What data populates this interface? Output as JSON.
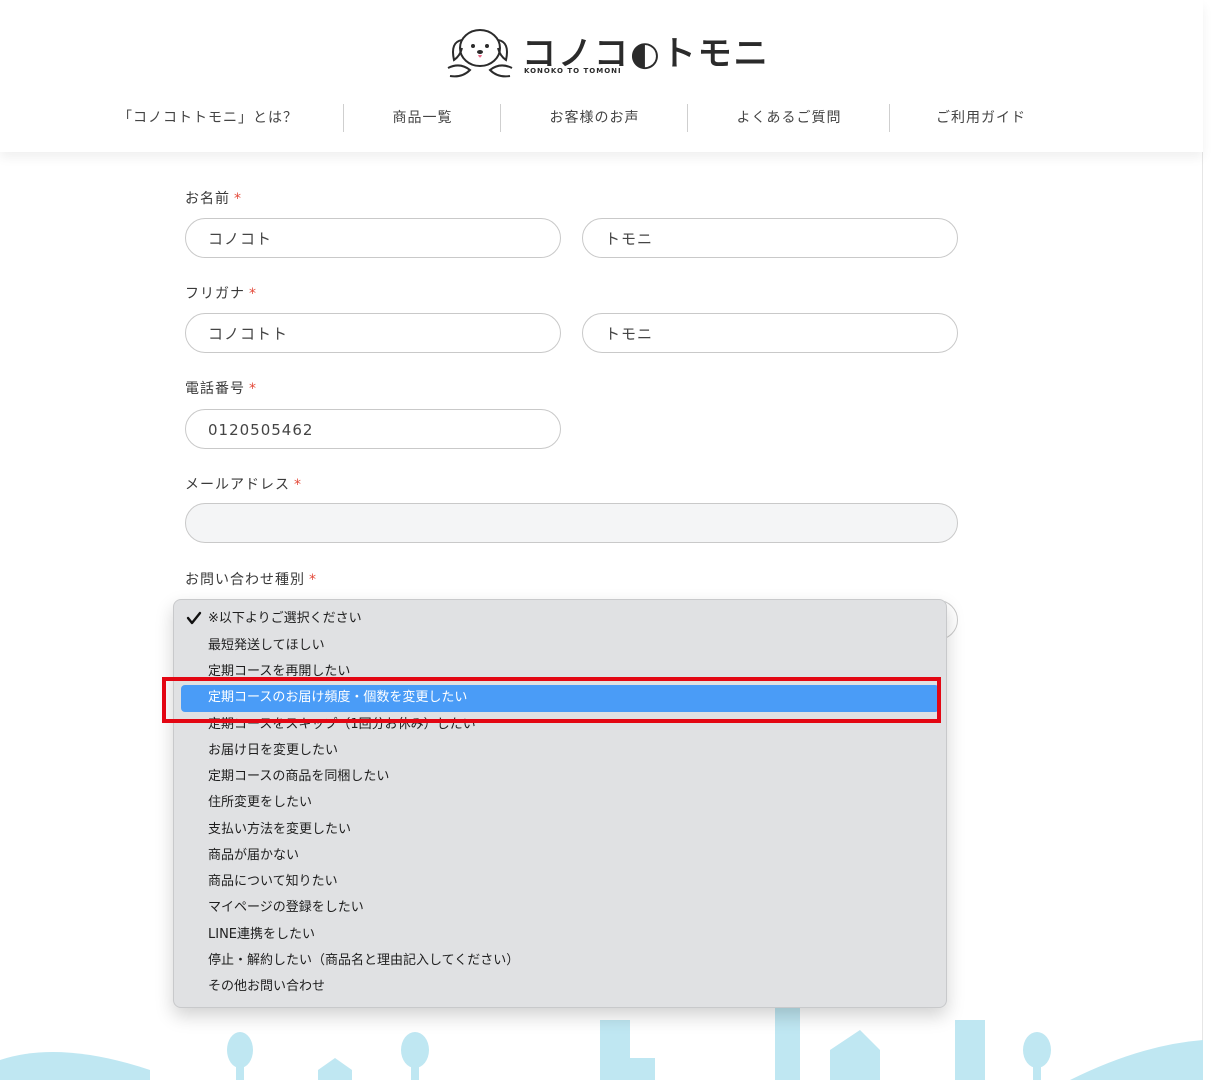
{
  "header": {
    "logo_text": "コノコ◐トモニ",
    "logo_sub": "KONOKO TO TOMONI",
    "nav": [
      {
        "label": "「コノコトトモニ」とは？"
      },
      {
        "label": "商品一覧"
      },
      {
        "label": "お客様のお声"
      },
      {
        "label": "よくあるご質問"
      },
      {
        "label": "ご利用ガイド"
      }
    ]
  },
  "form": {
    "required_mark": "*",
    "name": {
      "label": "お名前",
      "last_value": "コノコト",
      "first_value": "トモニ"
    },
    "furigana": {
      "label": "フリガナ",
      "last_value": "コノコトト",
      "first_value": "トモニ"
    },
    "phone": {
      "label": "電話番号",
      "value": "0120505462"
    },
    "email": {
      "label": "メールアドレス",
      "value": ""
    },
    "inquiry": {
      "label": "お問い合わせ種別"
    }
  },
  "dropdown": {
    "options": [
      "※以下よりご選択ください",
      "最短発送してほしい",
      "定期コースを再開したい",
      "定期コースのお届け頻度・個数を変更したい",
      "定期コースをスキップ（1回分お休み）したい",
      "お届け日を変更したい",
      "定期コースの商品を同梱したい",
      "住所変更をしたい",
      "支払い方法を変更したい",
      "商品が届かない",
      "商品について知りたい",
      "マイページの登録をしたい",
      "LINE連携をしたい",
      "停止・解約したい（商品名と理由記入してください）",
      "その他お問い合わせ"
    ],
    "checked_index": 0,
    "highlighted_index": 3
  },
  "colors": {
    "accent_required": "#e44a3a",
    "highlight": "#4a9cf7",
    "annotation_box": "#e30613",
    "scenery": "#bfe7f2"
  }
}
